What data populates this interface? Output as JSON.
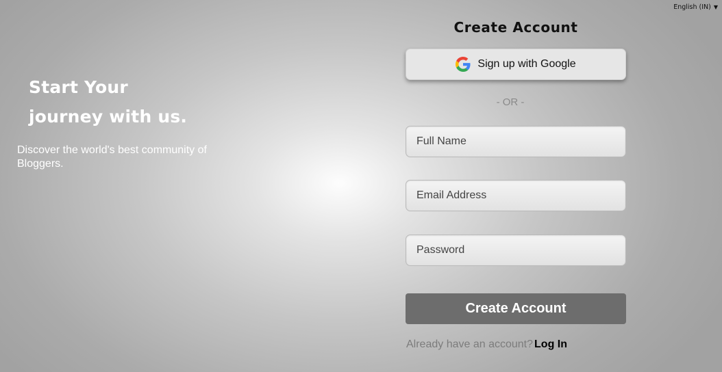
{
  "language_selector": {
    "label": "English (IN)",
    "icon": "caret-down-icon"
  },
  "hero": {
    "title_line1": "Start Your",
    "title_line2": "journey with us.",
    "subtitle": "Discover the world's best community of Bloggers."
  },
  "form": {
    "title": "Create Account",
    "google_button": {
      "label": "Sign up with Google",
      "icon": "google-icon"
    },
    "divider": "- OR -",
    "fields": {
      "full_name": {
        "placeholder": "Full Name",
        "value": ""
      },
      "email": {
        "placeholder": "Email Address",
        "value": ""
      },
      "password": {
        "placeholder": "Password",
        "value": ""
      }
    },
    "submit_label": "Create Account",
    "login_prompt": "Already have an account?",
    "login_link": "Log In"
  },
  "colors": {
    "submit_button_bg": "#6d6d6d",
    "google_button_bg": "#e6e6e6",
    "hero_text": "#ffffff"
  }
}
